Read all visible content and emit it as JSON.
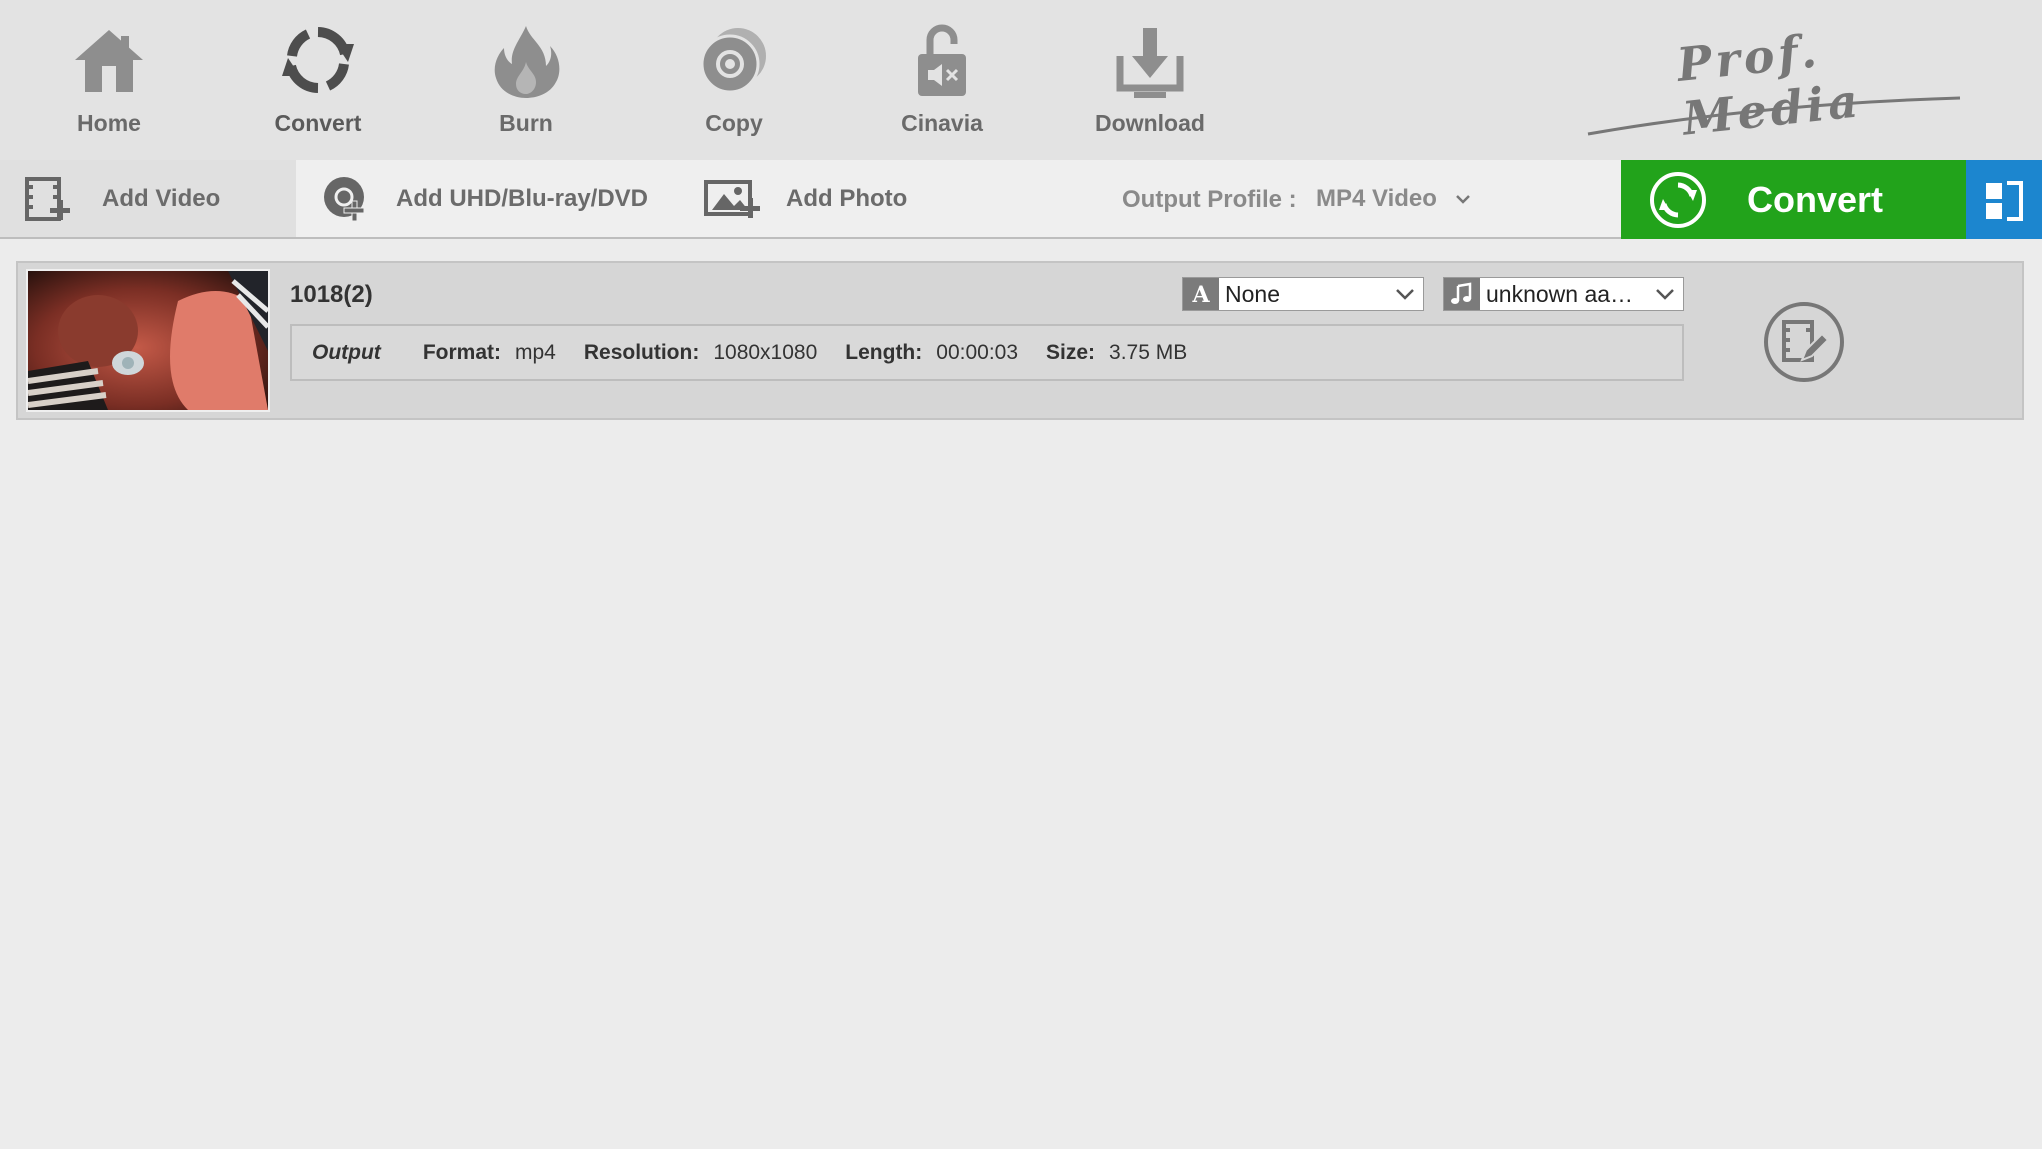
{
  "nav": {
    "items": [
      {
        "label": "Home",
        "icon": "home-icon"
      },
      {
        "label": "Convert",
        "icon": "convert-icon"
      },
      {
        "label": "Burn",
        "icon": "flame-icon"
      },
      {
        "label": "Copy",
        "icon": "disc-copy-icon"
      },
      {
        "label": "Cinavia",
        "icon": "unlock-mute-icon"
      },
      {
        "label": "Download",
        "icon": "download-icon"
      }
    ],
    "brand": "Prof. Media"
  },
  "toolbar": {
    "add_video": "Add Video",
    "add_disc": "Add UHD/Blu-ray/DVD",
    "add_photo": "Add Photo",
    "output_profile_label": "Output Profile :",
    "output_profile_value": "MP4 Video",
    "convert_label": "Convert"
  },
  "colors": {
    "convert_green": "#22a31b",
    "layout_blue": "#1c86cf"
  },
  "file": {
    "name": "1018(2)",
    "subtitle": "None",
    "audio": "unknown aa…",
    "output": {
      "title": "Output",
      "format_label": "Format:",
      "format": "mp4",
      "resolution_label": "Resolution:",
      "resolution": "1080x1080",
      "length_label": "Length:",
      "length": "00:00:03",
      "size_label": "Size:",
      "size": "3.75 MB"
    }
  }
}
